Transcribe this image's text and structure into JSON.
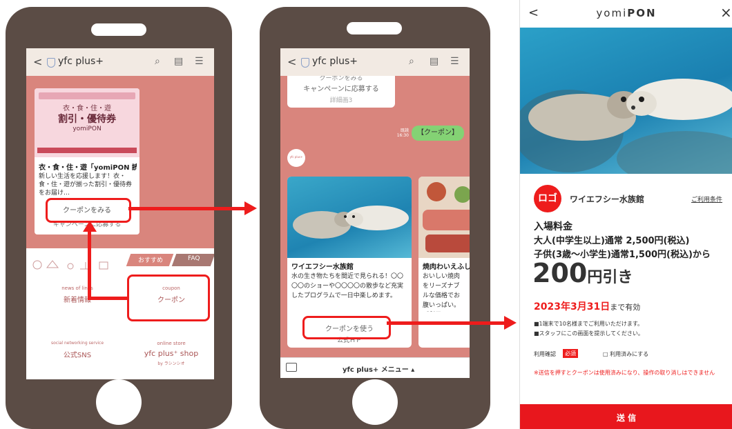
{
  "phone1": {
    "app_name": "yfc plus+",
    "card": {
      "banner_lines": [
        "衣・食・住・遊",
        "割引・優待券",
        "yomiPON"
      ],
      "title": "衣・食・住・遊「yomiPON 読…",
      "desc": "新しい生活を応援します！衣・食・住・遊が揃った割引・優待券をお届け…",
      "coupon_button": "クーポンをみる",
      "campaign_button": "キャンペーンに応募する"
    },
    "tabs": [
      "おすすめ",
      "FAQ"
    ],
    "menu": {
      "news_sub": "news of lines",
      "news": "新着情報",
      "coupon_sub": "coupon",
      "coupon": "クーポン",
      "sns_sub": "social networking service",
      "sns": "公式SNS",
      "shop_sub": "online store",
      "shop": "yfc plus⁺ shop",
      "shop_by": "by ラシンシオ"
    }
  },
  "phone2": {
    "app_name": "yfc plus+",
    "top_card": {
      "line1": "クーポンをみる",
      "line2": "キャンペーンに応募する",
      "line3": "詳細画3"
    },
    "msg_time": "既読\n16:30",
    "msg_text": "【クーポン】",
    "avatar_text": "yfc plus+",
    "card1": {
      "title": "ワイエフシー水族館",
      "desc": "水の生き物たちを間近で見られる！〇〇〇〇のショーや〇〇〇〇の散歩など充実したプログラムで一日中楽しめます。",
      "coupon_button": "クーポンを使う",
      "link": "公式ＨＰ"
    },
    "card2": {
      "title": "焼肉わいえふし…",
      "desc": "おいしい焼肉をリーズナブルな価格でお腹いっぱい。ご利用シーンに合わせた食べ放題メニュー…"
    },
    "bottom_menu": "yfc plus+ メニュー ▴"
  },
  "phone3": {
    "header_back": "<",
    "header_title_prefix": "yomi",
    "header_title_bold": "PON",
    "header_close": "×",
    "logo": "ロゴ",
    "shop_name": "ワイエフシー水族館",
    "terms_link": "ご利用条件",
    "price_title": "入場料金",
    "price_adult": "大人(中学生以上)通常 2,500円(税込)",
    "price_child": "子供(3歳〜小学生)通常1,500円(税込)から",
    "discount_amount": "200",
    "discount_unit": "円引き",
    "valid_date": "2023年3月31日",
    "valid_suffix": "まで有効",
    "note1": "■1端末で10名様までご利用いただけます。",
    "note2": "■スタッフにこの画面を提示してください。",
    "confirm_label": "利用確認",
    "required_badge": "必須",
    "used_checkbox": "□ 利用済みにする",
    "warning": "※送信を押すとクーポンは使用済みになり、操作の取り消しはできません",
    "send_button": "送 信"
  },
  "colors": {
    "accent_red": "#ee1c1c",
    "phone_body": "#5b4c45",
    "line_bg": "#d9857d"
  }
}
